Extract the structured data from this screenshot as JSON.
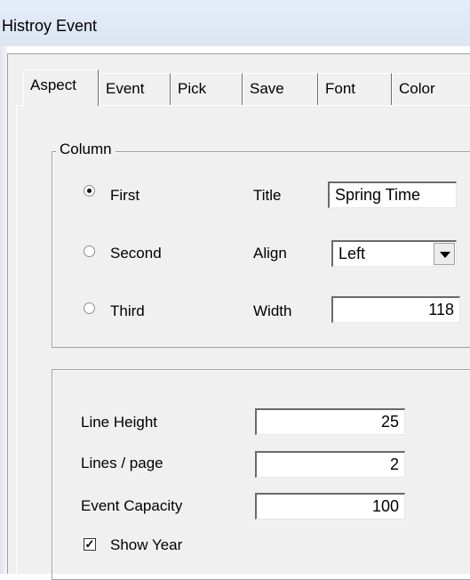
{
  "window": {
    "title": "Histroy Event"
  },
  "tabs": [
    {
      "label": "Aspect",
      "active": true
    },
    {
      "label": "Event"
    },
    {
      "label": "Pick"
    },
    {
      "label": "Save"
    },
    {
      "label": "Font"
    },
    {
      "label": "Color"
    }
  ],
  "column": {
    "legend": "Column",
    "options": [
      {
        "label": "First",
        "selected": true
      },
      {
        "label": "Second",
        "selected": false
      },
      {
        "label": "Third",
        "selected": false
      }
    ],
    "title_label": "Title",
    "title_value": "Spring Time",
    "align_label": "Align",
    "align_value": "Left",
    "width_label": "Width",
    "width_value": "118"
  },
  "settings": {
    "line_height_label": "Line Height",
    "line_height_value": "25",
    "lines_per_page_label": "Lines / page",
    "lines_per_page_value": "2",
    "event_capacity_label": "Event Capacity",
    "event_capacity_value": "100",
    "show_year_label": "Show Year",
    "show_year_checked": true
  }
}
